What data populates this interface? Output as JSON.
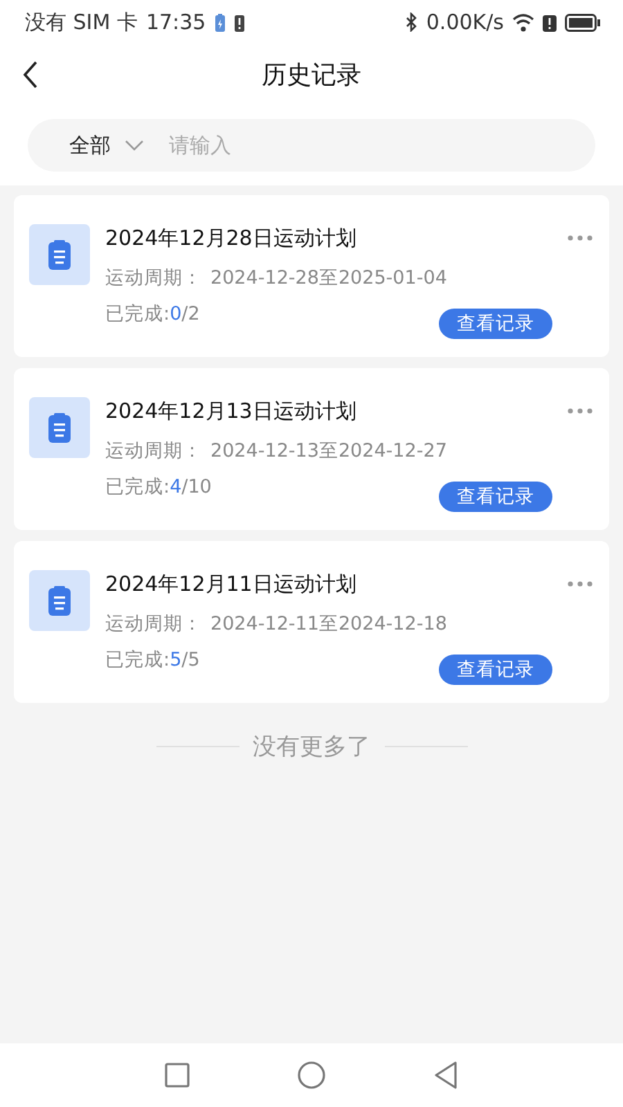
{
  "status_bar": {
    "carrier": "没有 SIM 卡",
    "time": "17:35",
    "speed": "0.00K/s"
  },
  "header": {
    "title": "历史记录"
  },
  "search": {
    "filter": "全部",
    "placeholder": "请输入"
  },
  "plans": [
    {
      "title": "2024年12月28日运动计划",
      "period_label": "运动周期：",
      "period": "2024-12-28至2025-01-04",
      "done_label": "已完成:",
      "done": "0",
      "total": "/2",
      "button": "查看记录"
    },
    {
      "title": "2024年12月13日运动计划",
      "period_label": "运动周期：",
      "period": "2024-12-13至2024-12-27",
      "done_label": "已完成:",
      "done": "4",
      "total": "/10",
      "button": "查看记录"
    },
    {
      "title": "2024年12月11日运动计划",
      "period_label": "运动周期：",
      "period": "2024-12-11至2024-12-18",
      "done_label": "已完成:",
      "done": "5",
      "total": "/5",
      "button": "查看记录"
    }
  ],
  "end_text": "没有更多了"
}
